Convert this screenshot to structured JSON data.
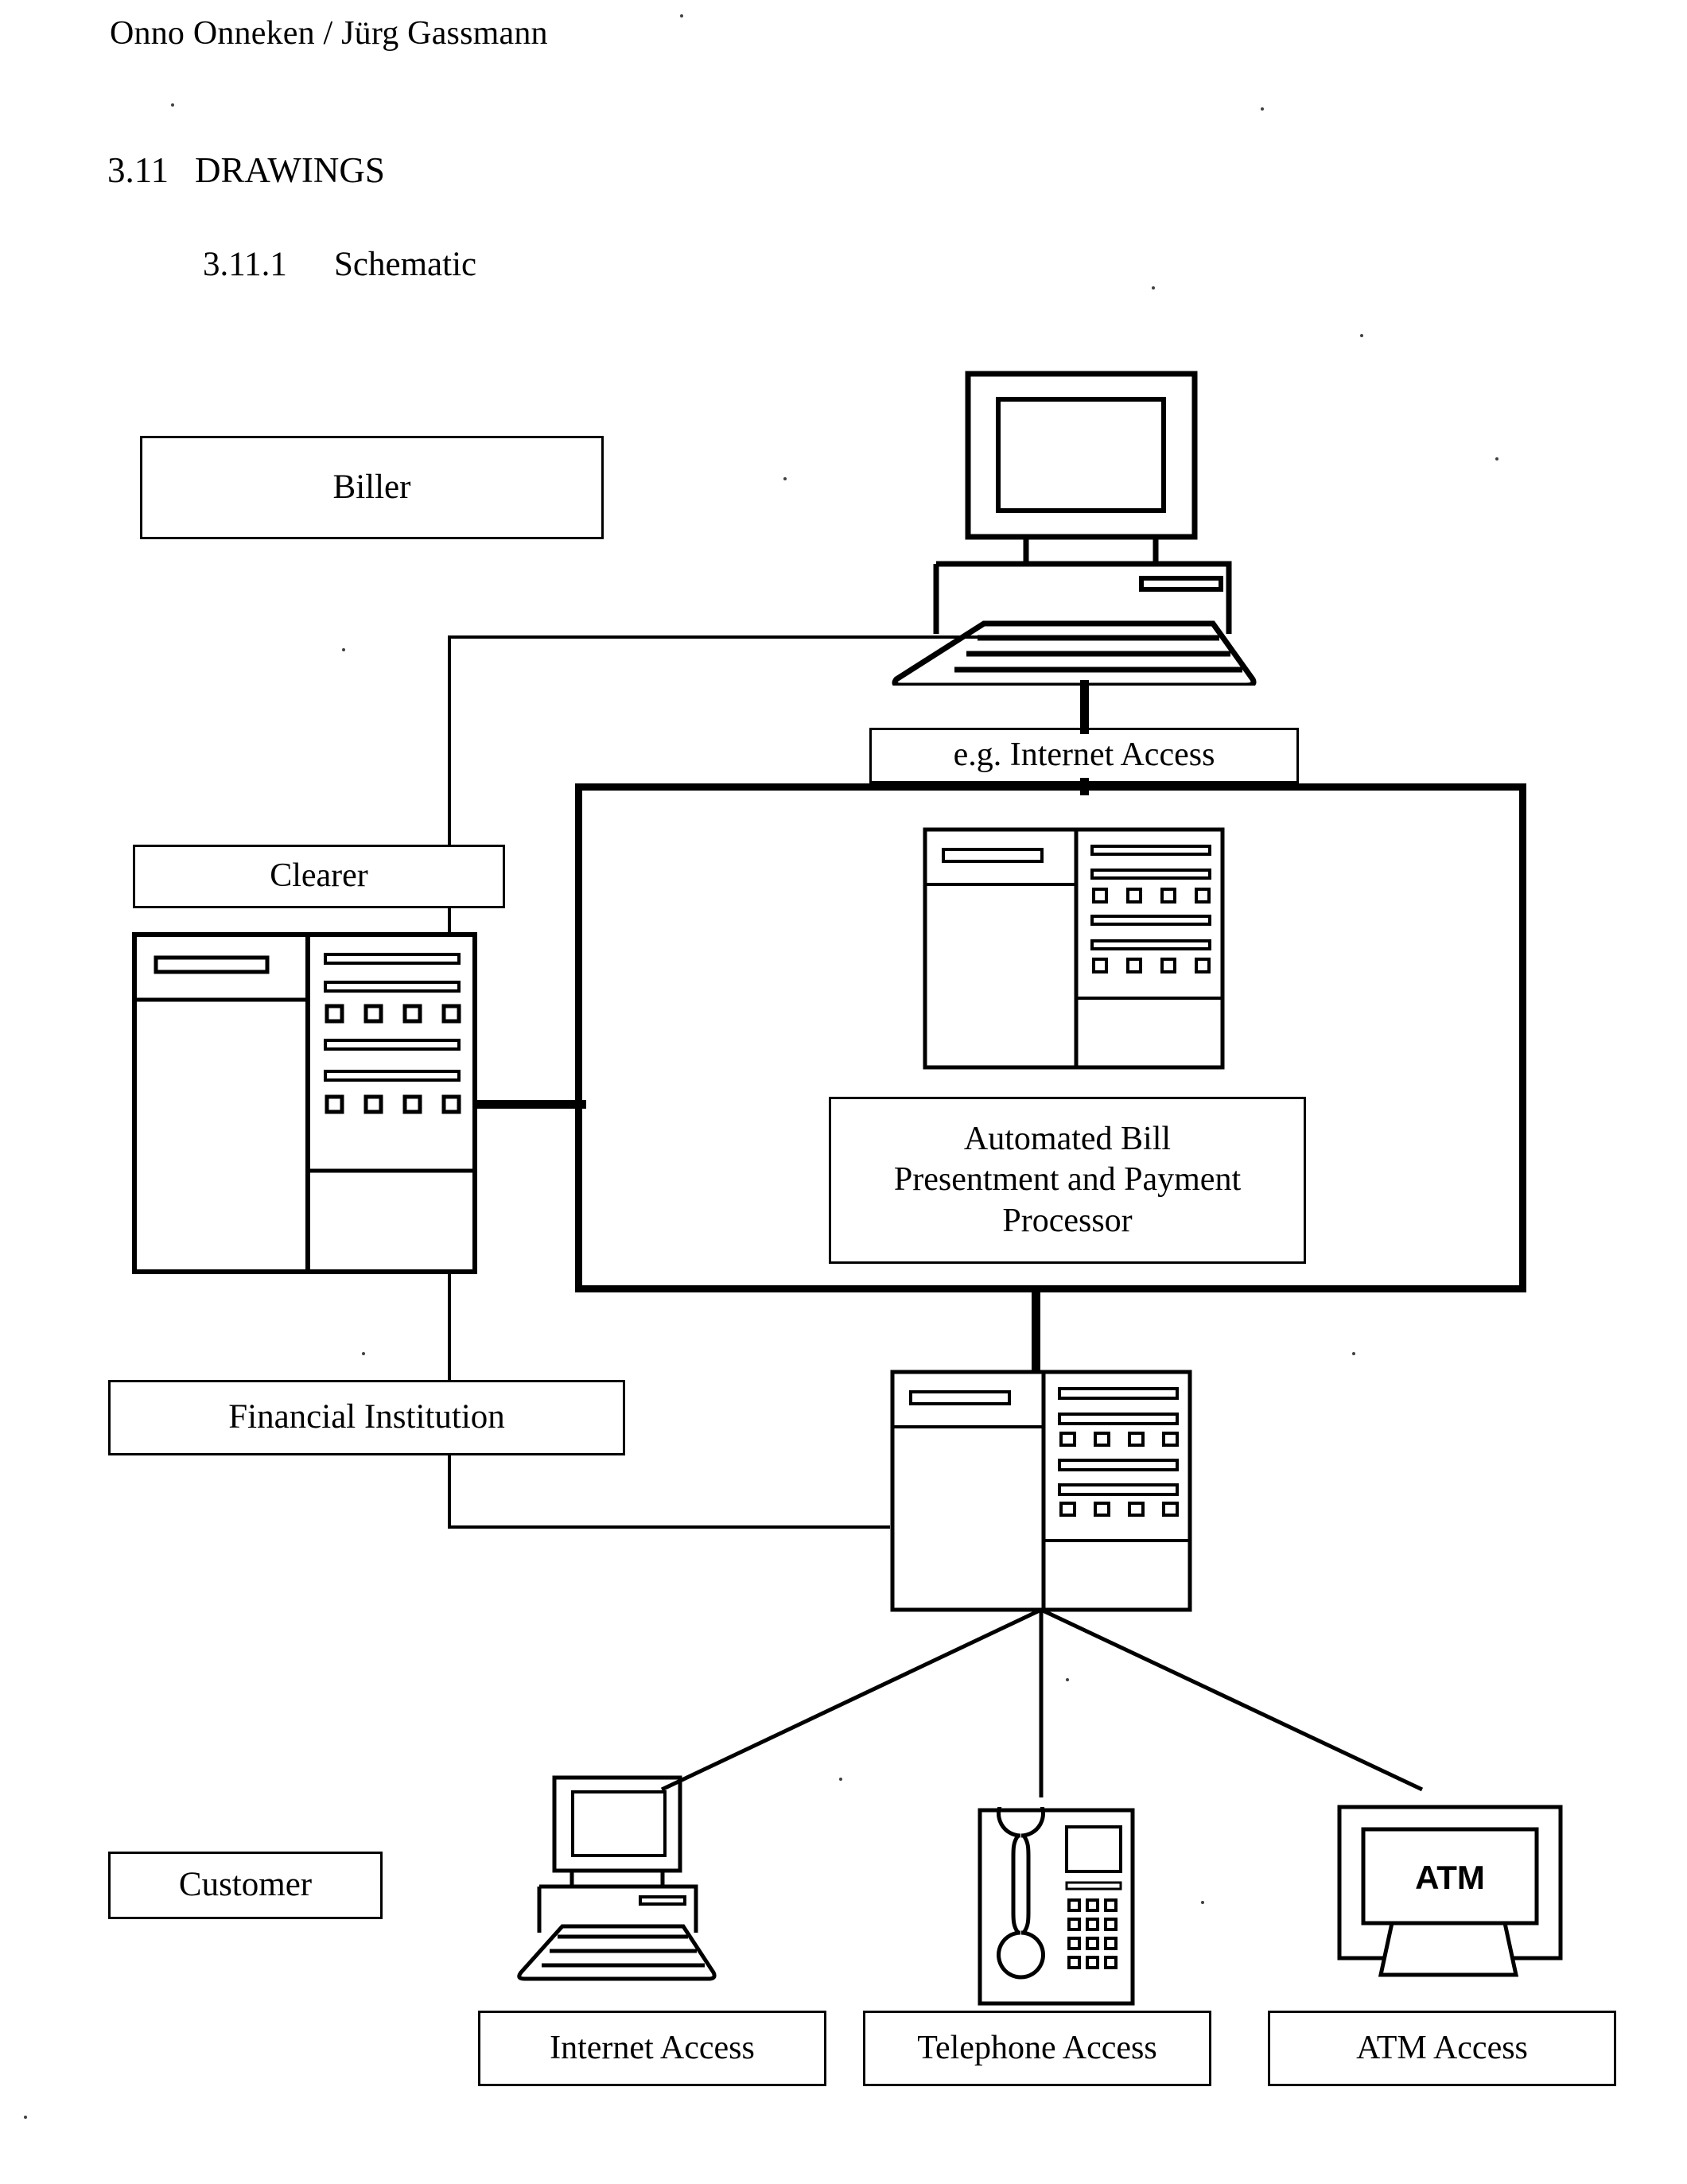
{
  "document": {
    "authors": "Onno Onneken / Jürg Gassmann",
    "section_number": "3.11",
    "section_title": "DRAWINGS",
    "subsection_number": "3.11.1",
    "subsection_title": "Schematic"
  },
  "diagram": {
    "type": "schematic-block-diagram",
    "nodes": {
      "biller": "Biller",
      "clearer": "Clearer",
      "financial_institution": "Financial Institution",
      "customer": "Customer",
      "internet_access_example": "e.g. Internet Access",
      "processor": {
        "line1": "Automated Bill",
        "line2": "Presentment and Payment",
        "line3": "Processor"
      },
      "atm_screen_label": "ATM",
      "internet_access": "Internet Access",
      "telephone_access": "Telephone Access",
      "atm_access": "ATM Access"
    },
    "icons": {
      "biller_workstation": "desktop-computer-icon",
      "clearer_server": "server-tower-icon",
      "processor_server": "server-tower-icon",
      "customer_facing_server": "server-tower-icon",
      "customer_workstation": "desktop-computer-icon",
      "customer_telephone": "telephone-icon",
      "customer_atm": "atm-icon"
    },
    "colors": {
      "ink": "#000000",
      "paper": "#ffffff"
    }
  }
}
